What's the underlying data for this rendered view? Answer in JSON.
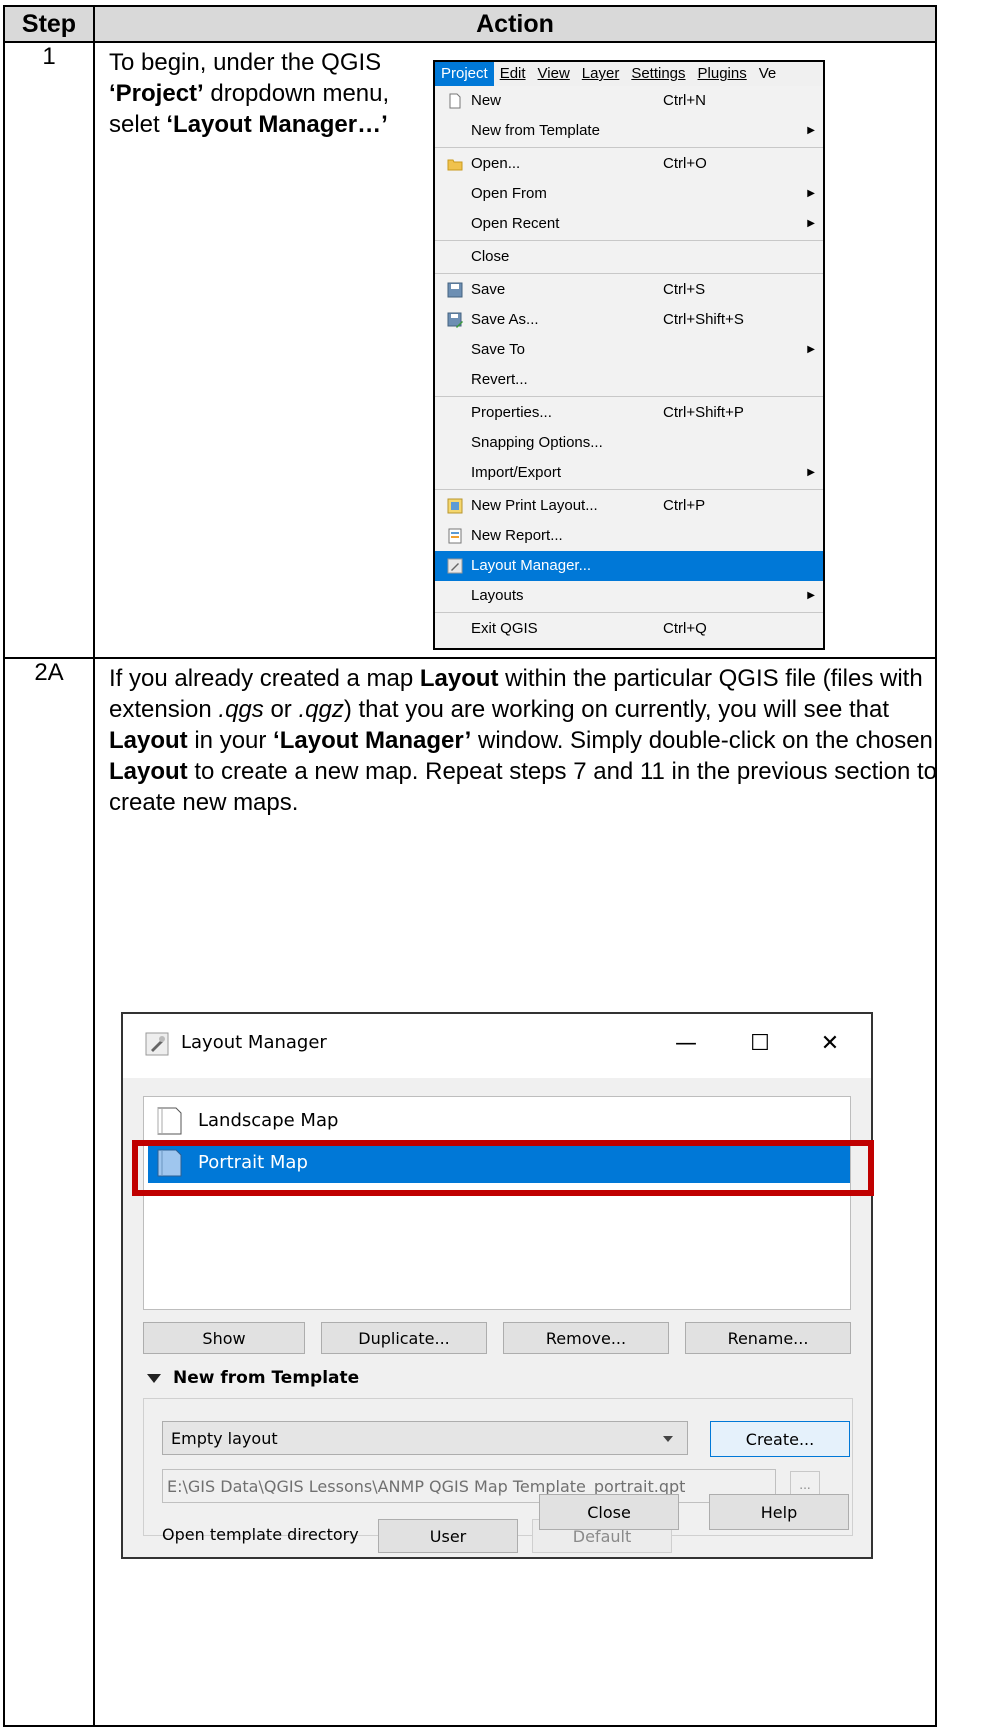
{
  "table": {
    "header_step": "Step",
    "header_action": "Action"
  },
  "row1": {
    "step": "1",
    "text_parts": [
      "To begin, under the QGIS ",
      "‘Project’",
      " dropdown menu, selet ",
      "‘Layout Manager…’"
    ]
  },
  "menu": {
    "bar": [
      "Project",
      "Edit",
      "View",
      "Layer",
      "Settings",
      "Plugins",
      "Ve"
    ],
    "items": [
      {
        "label": "New",
        "shortcut": "Ctrl+N",
        "icon": "new-file-icon"
      },
      {
        "label": "New from Template",
        "submenu": true
      },
      {
        "label": "Open...",
        "shortcut": "Ctrl+O",
        "icon": "folder-icon"
      },
      {
        "label": "Open From",
        "submenu": true
      },
      {
        "label": "Open Recent",
        "submenu": true
      },
      {
        "label": "Close"
      },
      {
        "label": "Save",
        "shortcut": "Ctrl+S",
        "icon": "save-icon"
      },
      {
        "label": "Save As...",
        "shortcut": "Ctrl+Shift+S",
        "icon": "save-as-icon"
      },
      {
        "label": "Save To",
        "submenu": true
      },
      {
        "label": "Revert..."
      },
      {
        "label": "Properties...",
        "shortcut": "Ctrl+Shift+P"
      },
      {
        "label": "Snapping Options..."
      },
      {
        "label": "Import/Export",
        "submenu": true
      },
      {
        "label": "New Print Layout...",
        "shortcut": "Ctrl+P",
        "icon": "print-layout-icon"
      },
      {
        "label": "New Report...",
        "icon": "report-icon"
      },
      {
        "label": "Layout Manager...",
        "icon": "layout-manager-icon",
        "selected": true
      },
      {
        "label": "Layouts",
        "submenu": true
      },
      {
        "label": "Exit QGIS",
        "shortcut": "Ctrl+Q"
      }
    ]
  },
  "row2": {
    "step": "2A",
    "text_parts": [
      "If you already created a map ",
      "Layout",
      " within the particular QGIS file (files with extension ",
      ".qgs",
      " or ",
      ".qgz",
      ") that you are working on currently, you will see that ",
      "Layout",
      " in your ",
      "‘Layout Manager’",
      " window.  Simply double-click on the chosen ",
      "Layout",
      " to create a new map.  Repeat steps 7 and 11 in the previous section to create new maps."
    ]
  },
  "dialog": {
    "title": "Layout Manager",
    "minimize": "—",
    "maximize": "☐",
    "close": "✕",
    "layouts": [
      "Landscape Map",
      "Portrait Map"
    ],
    "buttons": [
      "Show",
      "Duplicate...",
      "Remove...",
      "Rename..."
    ],
    "group_title": "New from Template",
    "template_value": "Empty layout",
    "create_label": "Create...",
    "path_value": "E:\\GIS Data\\QGIS Lessons\\ANMP QGIS Map Template_portrait.qpt",
    "browse_label": "...",
    "open_dir_label": "Open template directory",
    "user_label": "User",
    "default_label": "Default",
    "close_label": "Close",
    "help_label": "Help"
  },
  "colors": {
    "highlight": "#0078d7",
    "red_box": "#c00000",
    "header_bg": "#d9d9d9"
  }
}
